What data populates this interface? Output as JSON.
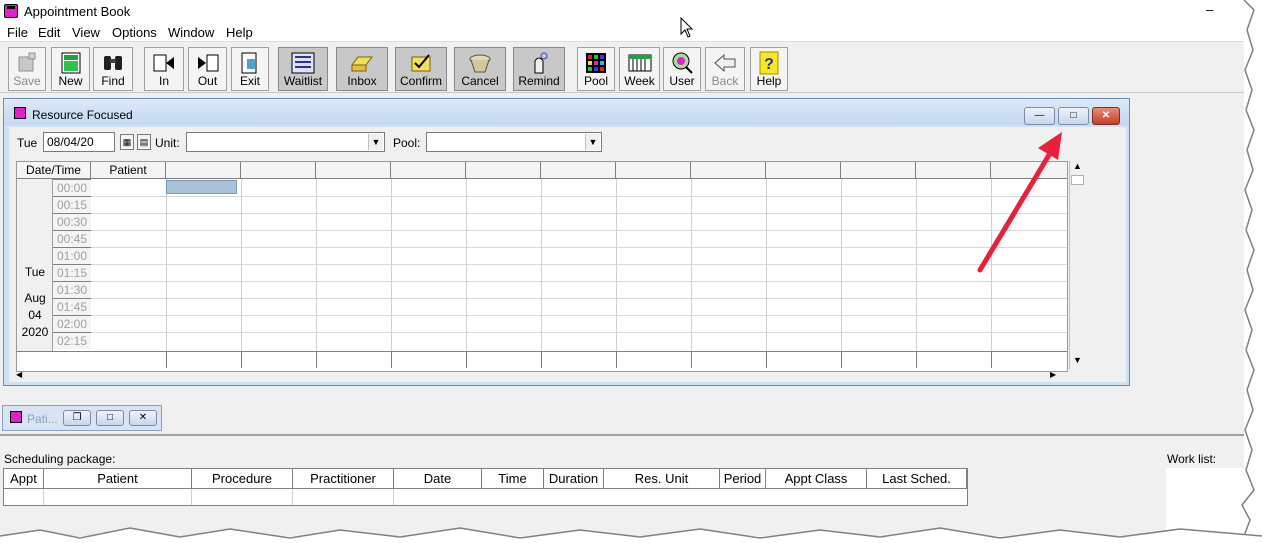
{
  "window": {
    "title": "Appointment Book",
    "minimize_glyph": "–"
  },
  "menu": [
    "File",
    "Edit",
    "View",
    "Options",
    "Window",
    "Help"
  ],
  "toolbar": [
    {
      "label": "Save",
      "icon": "save-icon",
      "disabled": true
    },
    {
      "label": "New",
      "icon": "new-icon"
    },
    {
      "label": "Find",
      "icon": "binoculars-icon"
    },
    {
      "label": "In",
      "icon": "check-in-icon"
    },
    {
      "label": "Out",
      "icon": "check-out-icon"
    },
    {
      "label": "Exit",
      "icon": "exit-icon"
    },
    {
      "label": "Waitlist",
      "icon": "waitlist-icon"
    },
    {
      "label": "Inbox",
      "icon": "inbox-icon"
    },
    {
      "label": "Confirm",
      "icon": "confirm-icon"
    },
    {
      "label": "Cancel",
      "icon": "cancel-icon"
    },
    {
      "label": "Remind",
      "icon": "remind-icon"
    },
    {
      "label": "Pool",
      "icon": "pool-icon"
    },
    {
      "label": "Week",
      "icon": "week-icon"
    },
    {
      "label": "User",
      "icon": "user-icon"
    },
    {
      "label": "Back",
      "icon": "back-icon",
      "disabled": true
    },
    {
      "label": "Help",
      "icon": "help-icon"
    }
  ],
  "resource_window": {
    "title": "Resource Focused",
    "day_label": "Tue",
    "date_value": "08/04/20",
    "unit_label": "Unit:",
    "pool_label": "Pool:",
    "unit_value": "",
    "pool_value": ""
  },
  "grid": {
    "headers": [
      "Date/Time",
      "Patient"
    ],
    "day": {
      "weekday": "Tue",
      "month": "Aug",
      "date": "04",
      "year": "2020"
    },
    "times": [
      "00:00",
      "00:15",
      "00:30",
      "00:45",
      "01:00",
      "01:15",
      "01:30",
      "01:45",
      "02:00",
      "02:15"
    ]
  },
  "minimized_window": {
    "title": "Pati..."
  },
  "scheduling_package": {
    "label": "Scheduling package:",
    "columns": [
      "Appt",
      "Patient",
      "Procedure",
      "Practitioner",
      "Date",
      "Time",
      "Duration",
      "Res. Unit",
      "Period",
      "Appt Class",
      "Last Sched."
    ]
  },
  "work_list": {
    "label": "Work list:"
  },
  "colors": {
    "accent_pink": "#e020c8",
    "annotation_arrow": "#e8203a",
    "selected_cell": "#a8c0d8",
    "inner_title_bar": "#cde0f4"
  }
}
